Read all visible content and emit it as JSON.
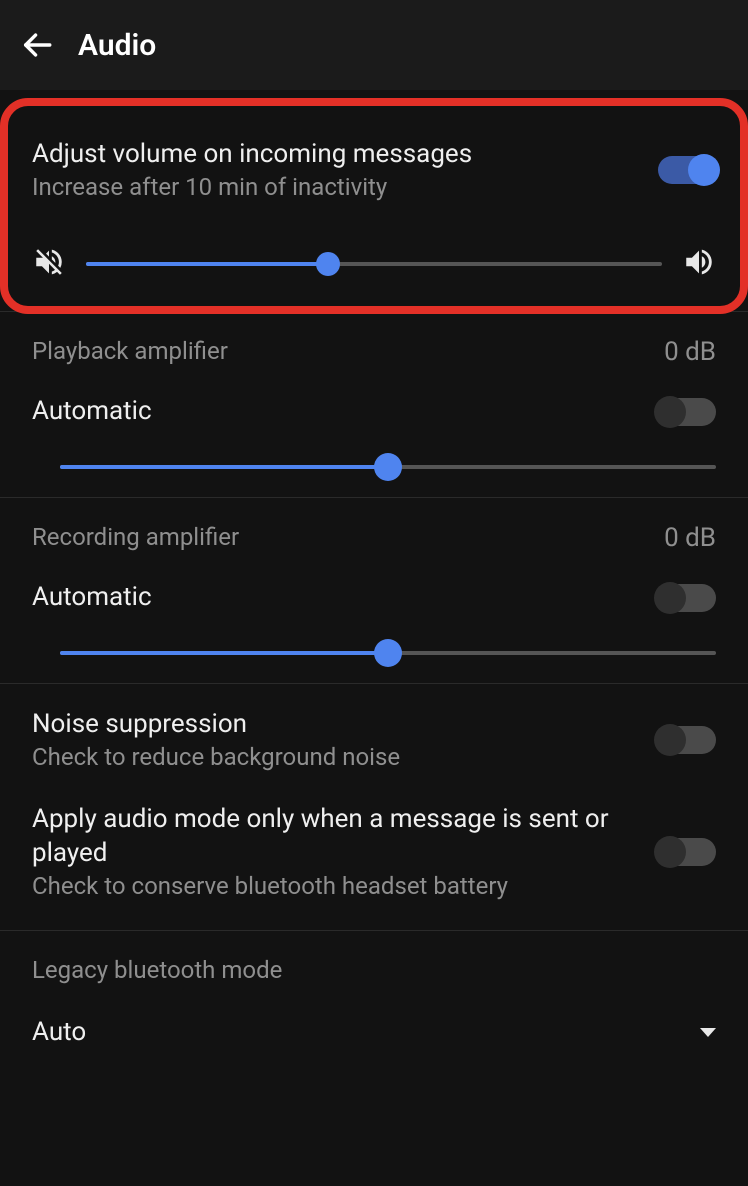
{
  "header": {
    "title": "Audio"
  },
  "adjust": {
    "title": "Adjust volume on incoming messages",
    "subtitle": "Increase after 10 min of inactivity",
    "enabled": true,
    "slider_pct": 42
  },
  "playback": {
    "heading": "Playback amplifier",
    "value": "0 dB",
    "auto_label": "Automatic",
    "auto_enabled": false,
    "slider_pct": 50
  },
  "recording": {
    "heading": "Recording amplifier",
    "value": "0 dB",
    "auto_label": "Automatic",
    "auto_enabled": false,
    "slider_pct": 50
  },
  "noise": {
    "title": "Noise suppression",
    "subtitle": "Check to reduce background noise",
    "enabled": false
  },
  "audio_mode": {
    "title": "Apply audio mode only when a message is sent or played",
    "subtitle": "Check to conserve bluetooth headset battery",
    "enabled": false
  },
  "legacy_bt": {
    "heading": "Legacy bluetooth mode",
    "value": "Auto"
  }
}
